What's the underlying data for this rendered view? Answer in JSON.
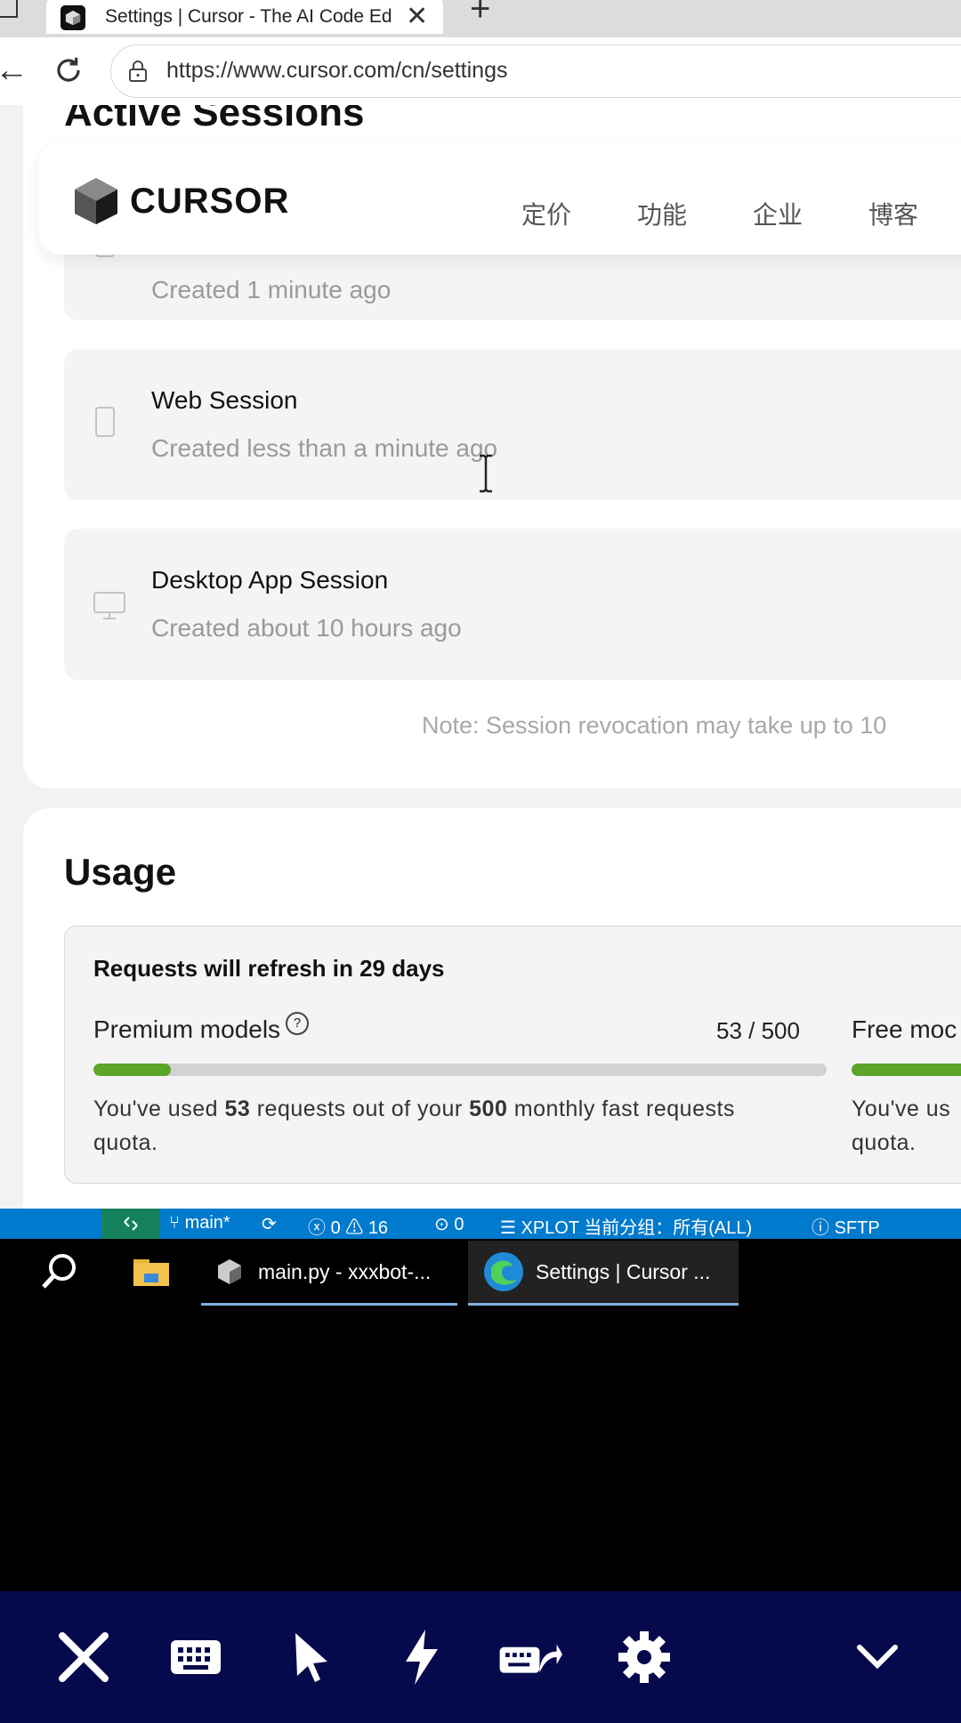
{
  "browser": {
    "tab_title": "Settings | Cursor - The AI Code Ed",
    "tab_close": "✕",
    "new_tab": "+",
    "url": "https://www.cursor.com/cn/settings"
  },
  "page": {
    "active_sessions_title": "Active Sessions",
    "nav": {
      "logo_text": "CURSOR",
      "links": [
        "定价",
        "功能",
        "企业",
        "博客"
      ]
    },
    "sessions": [
      {
        "name": "",
        "created": "Created 1 minute ago",
        "device": "phone-icon"
      },
      {
        "name": "Web Session",
        "created": "Created less than a minute ago",
        "device": "phone-icon"
      },
      {
        "name": "Desktop App Session",
        "created": "Created about 10 hours ago",
        "device": "monitor-icon"
      }
    ],
    "note": "Note: Session revocation may take up to 10",
    "usage": {
      "title": "Usage",
      "refresh": "Requests will refresh in 29 days",
      "premium": {
        "label": "Premium models",
        "count": "53 / 500",
        "used": 53,
        "total": 500,
        "text_pre": "You've used ",
        "used_text": "53",
        "text_mid": " requests out of your ",
        "total_text": "500",
        "text_post": " monthly fast requests quota."
      },
      "free": {
        "label": "Free moc",
        "text": "You've us",
        "text2": "quota."
      }
    }
  },
  "statusbar": {
    "branch": "main*",
    "errors": "0",
    "warnings": "16",
    "ports": "0",
    "xplot": "XPLOT 当前分组：所有(ALL)",
    "sftp": "SFTP"
  },
  "taskbar": {
    "items": [
      "main.py - xxxbot-...",
      "Settings | Cursor ..."
    ]
  },
  "colors": {
    "progress": "#5aa52a",
    "statusbar": "#007acc",
    "toolbar": "#060a4d"
  }
}
